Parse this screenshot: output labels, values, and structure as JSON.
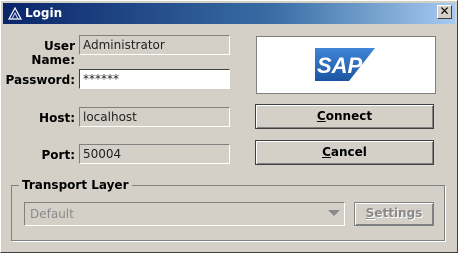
{
  "window": {
    "title": "Login",
    "close_glyph": "✖"
  },
  "form": {
    "username_label": "User Name:",
    "username_value": "Administrator",
    "password_label": "Password:",
    "password_value": "******",
    "host_label": "Host:",
    "host_value": "localhost",
    "port_label": "Port:",
    "port_value": "50004"
  },
  "logo": {
    "text": "SAP",
    "color": "#1f63b5"
  },
  "buttons": {
    "connect_first": "C",
    "connect_rest": "onnect",
    "cancel_first": "C",
    "cancel_rest": "ancel",
    "settings_first": "S",
    "settings_rest": "ettings"
  },
  "transport": {
    "group_title": "Transport Layer",
    "selected": "Default"
  },
  "colors": {
    "title_gradient_start": "#0a246a",
    "title_gradient_end": "#a6caf0",
    "window_bg": "#d4d0c8"
  }
}
